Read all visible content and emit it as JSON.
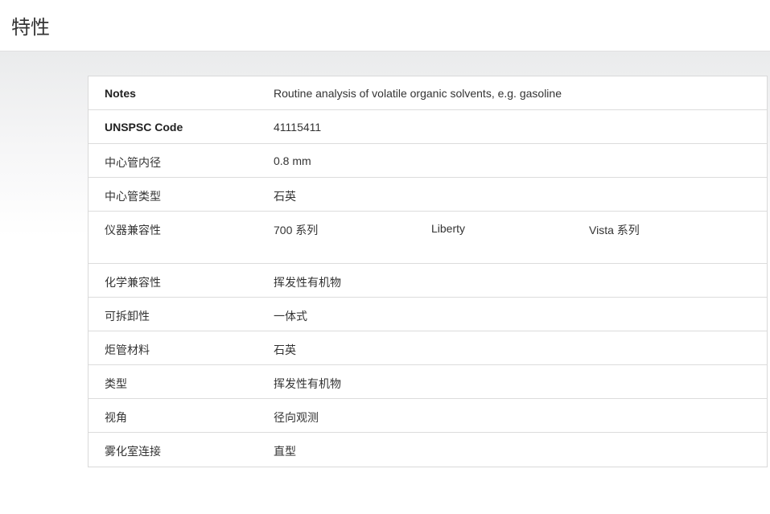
{
  "header": {
    "title": "特性"
  },
  "properties": [
    {
      "label": "Notes",
      "values": [
        "Routine analysis of volatile organic solvents, e.g. gasoline"
      ]
    },
    {
      "label": "UNSPSC Code",
      "values": [
        "41115411"
      ]
    },
    {
      "label": "中心管内径",
      "values": [
        "0.8 mm"
      ]
    },
    {
      "label": "中心管类型",
      "values": [
        "石英"
      ]
    },
    {
      "label": "仪器兼容性",
      "values": [
        "700 系列",
        "Liberty",
        "Vista 系列"
      ]
    },
    {
      "label": "化学兼容性",
      "values": [
        "挥发性有机物"
      ]
    },
    {
      "label": "可拆卸性",
      "values": [
        "一体式"
      ]
    },
    {
      "label": "炬管材料",
      "values": [
        "石英"
      ]
    },
    {
      "label": "类型",
      "values": [
        "挥发性有机物"
      ]
    },
    {
      "label": "视角",
      "values": [
        "径向观测"
      ]
    },
    {
      "label": "雾化室连接",
      "values": [
        "直型"
      ]
    }
  ]
}
